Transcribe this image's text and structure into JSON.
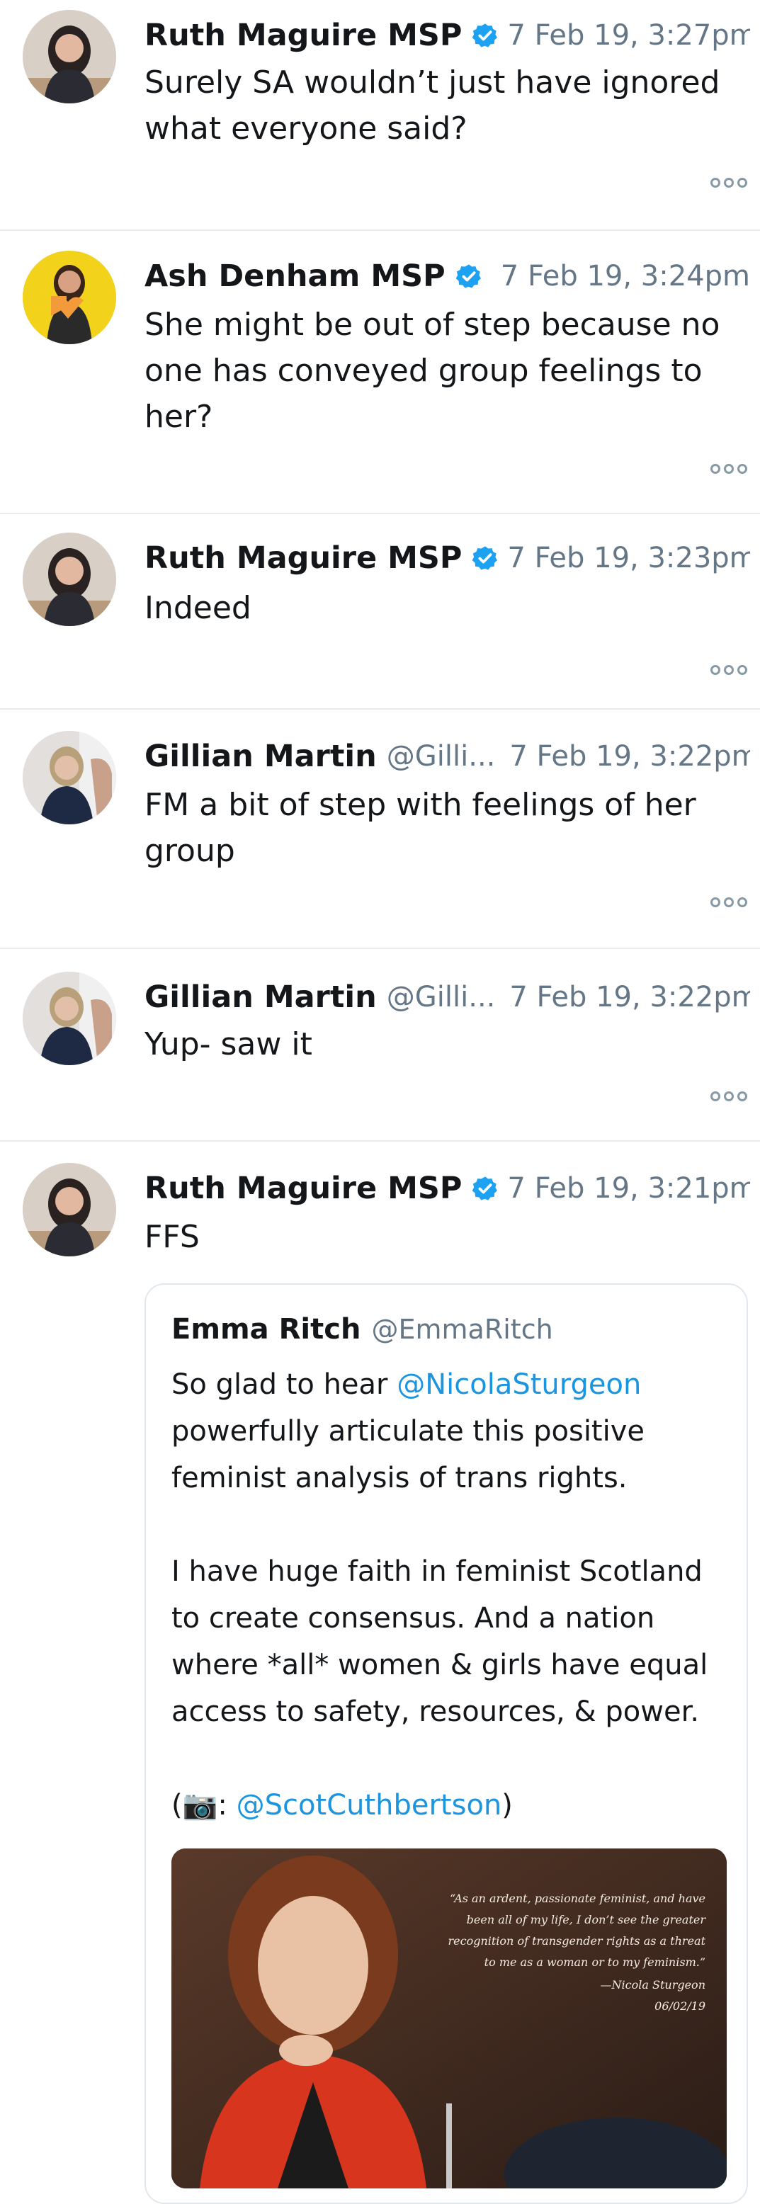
{
  "colors": {
    "verified": "#1da1f2",
    "link": "#1b95e0",
    "name_text": "#14171a",
    "secondary_text": "#657786",
    "divider": "#e6ecf0"
  },
  "icons": {
    "verified": "verified-badge-icon",
    "more": "more-options-icon",
    "camera": "camera-emoji"
  },
  "tweets": [
    {
      "name": "Ruth Maguire MSP",
      "verified": true,
      "time": "7 Feb 19, 3:27pm",
      "text": "Surely SA wouldn’t just have ignored what everyone said?"
    },
    {
      "name": "Ash Denham MSP",
      "verified": true,
      "time": "7 Feb 19, 3:24pm",
      "text": "She might be out of step because no one has conveyed group feelings to her?"
    },
    {
      "name": "Ruth Maguire MSP",
      "verified": true,
      "time": "7 Feb 19, 3:23pm",
      "text": "Indeed"
    },
    {
      "name": "Gillian Martin",
      "handle": "@Gilli...",
      "time": "7 Feb 19, 3:22pm",
      "text": "FM a bit of step with feelings of her group"
    },
    {
      "name": "Gillian Martin",
      "handle": "@Gilli...",
      "time": "7 Feb 19, 3:22pm",
      "text": "Yup- saw it"
    },
    {
      "name": "Ruth Maguire MSP",
      "verified": true,
      "time": "7 Feb 19, 3:21pm",
      "text": "FFS",
      "quoted": {
        "name": "Emma Ritch",
        "handle": "@EmmaRitch",
        "line1_before": "So glad to hear ",
        "mention": "@NicolaSturgeon",
        "line1_after": " powerfully articulate this positive feminist analysis of trans rights.",
        "paragraph2": "I have huge faith in feminist Scotland to create consensus. And a nation where *all* women & girls have equal access to safety, resources, & power.",
        "credit_open": "(",
        "camera_emoji": "📷",
        "credit_sep": ": ",
        "credit_mention": "@ScotCuthbertson",
        "credit_close": ")",
        "image_quote": "“As an ardent, passionate feminist, and have been all of my life, I don’t see the greater recognition of transgender rights as a threat to me as a woman or to my feminism.”",
        "image_signature": "—Nicola Sturgeon",
        "image_date": "06/02/19"
      }
    }
  ]
}
